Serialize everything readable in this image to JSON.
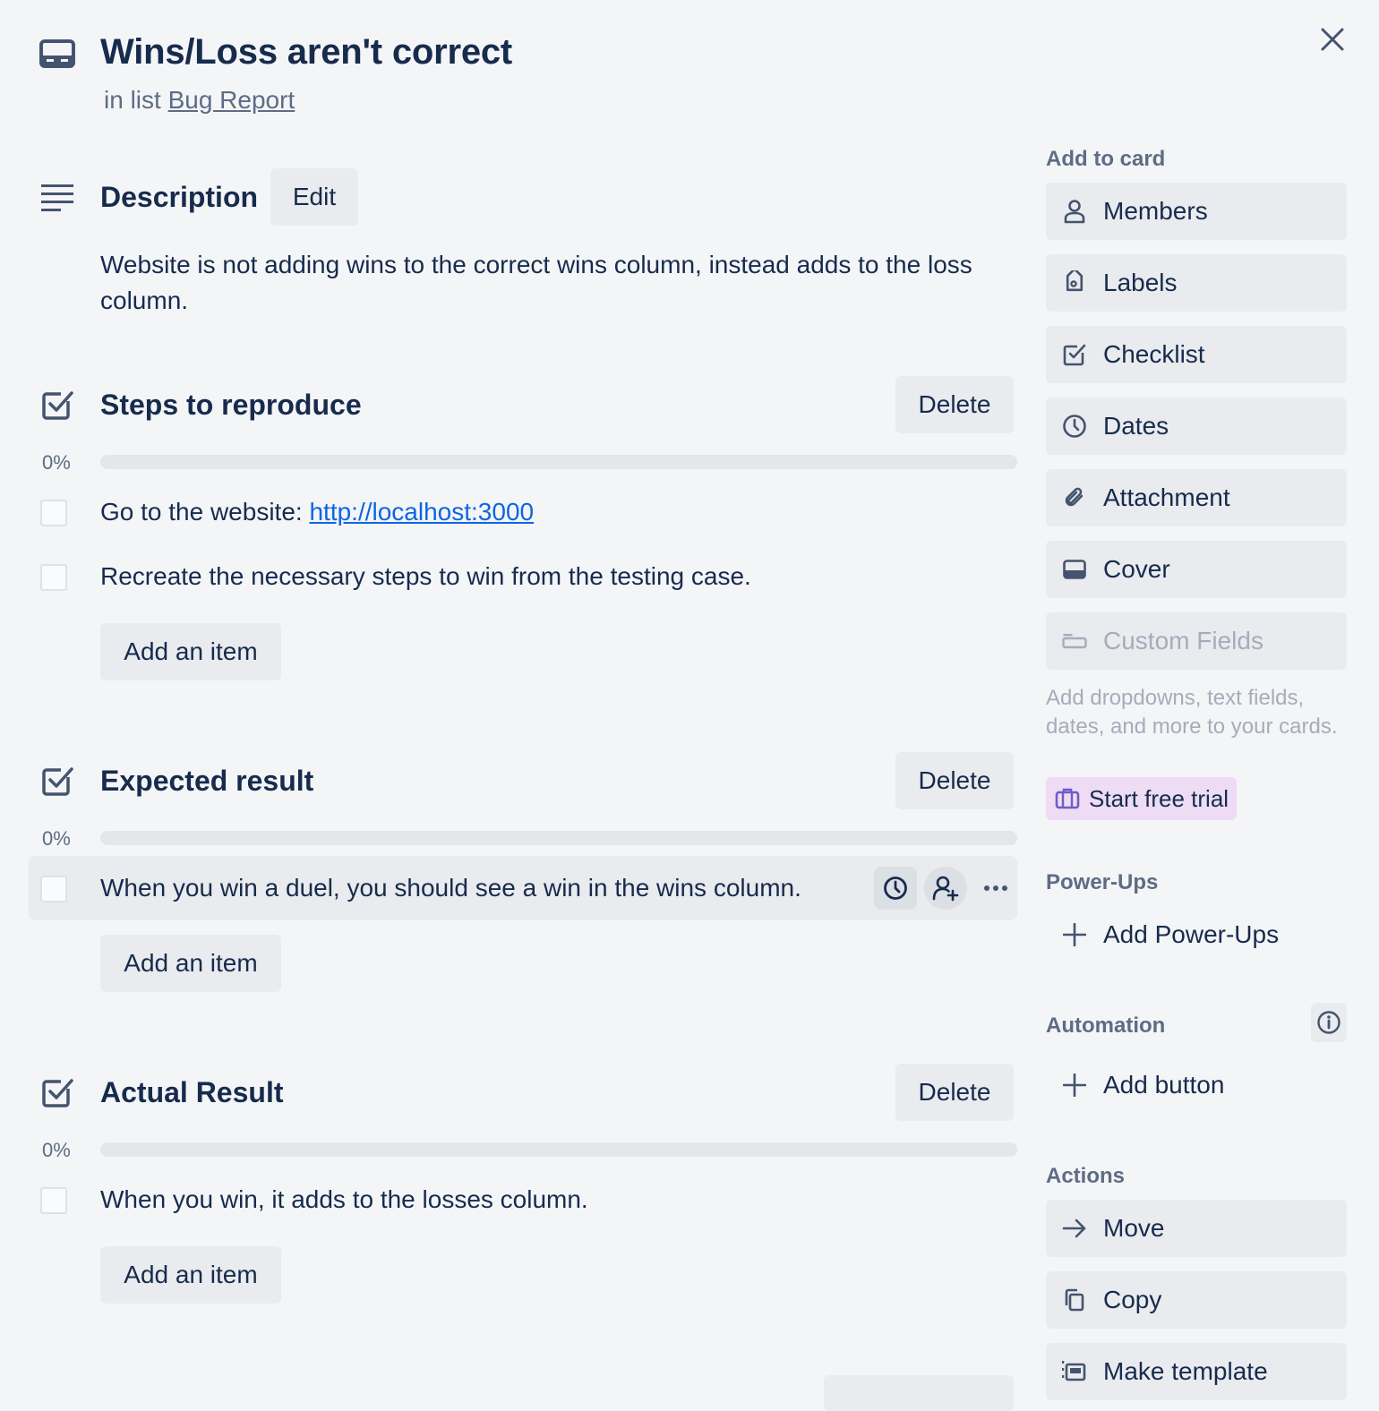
{
  "card": {
    "title": "Wins/Loss aren't correct",
    "in_list_prefix": "in list",
    "list_name": "Bug Report"
  },
  "description": {
    "title": "Description",
    "edit_label": "Edit",
    "text": "Website is not adding wins to the correct wins column, instead adds to the loss column."
  },
  "checklists": [
    {
      "title": "Steps to reproduce",
      "delete_label": "Delete",
      "progress_label": "0%",
      "progress": 0,
      "items": [
        {
          "text": "Go to the website: ",
          "link": "http://localhost:3000",
          "checked": false
        },
        {
          "text": "Recreate the necessary steps to win from the testing case.",
          "checked": false
        }
      ],
      "add_label": "Add an item"
    },
    {
      "title": "Expected result",
      "delete_label": "Delete",
      "progress_label": "0%",
      "progress": 0,
      "items": [
        {
          "text": "When you win a duel, you should see a win in the wins column.",
          "checked": false
        }
      ],
      "add_label": "Add an item"
    },
    {
      "title": "Actual Result",
      "delete_label": "Delete",
      "progress_label": "0%",
      "progress": 0,
      "items": [
        {
          "text": "When you win, it adds to the losses column.",
          "checked": false
        }
      ],
      "add_label": "Add an item"
    }
  ],
  "sidebar": {
    "add_to_card_label": "Add to card",
    "add_to_card": [
      {
        "label": "Members",
        "icon": "person-icon"
      },
      {
        "label": "Labels",
        "icon": "tag-icon"
      },
      {
        "label": "Checklist",
        "icon": "checklist-icon"
      },
      {
        "label": "Dates",
        "icon": "clock-icon"
      },
      {
        "label": "Attachment",
        "icon": "paperclip-icon"
      },
      {
        "label": "Cover",
        "icon": "cover-icon"
      },
      {
        "label": "Custom Fields",
        "icon": "custom-fields-icon",
        "disabled": true
      }
    ],
    "custom_fields_desc": "Add dropdowns, text fields, dates, and more to your cards.",
    "start_trial_label": "Start free trial",
    "powerups_label": "Power-Ups",
    "add_powerups_label": "Add Power-Ups",
    "automation_label": "Automation",
    "add_button_label": "Add button",
    "actions_label": "Actions",
    "actions": [
      {
        "label": "Move",
        "icon": "arrow-right-icon"
      },
      {
        "label": "Copy",
        "icon": "copy-icon"
      },
      {
        "label": "Make template",
        "icon": "template-icon"
      }
    ]
  },
  "colors": {
    "background": "#f4f5f7",
    "button": "#e9ebee",
    "text": "#172b4d",
    "muted": "#5e6c84",
    "link": "#0c66e4",
    "trial": "#eedcf5"
  }
}
